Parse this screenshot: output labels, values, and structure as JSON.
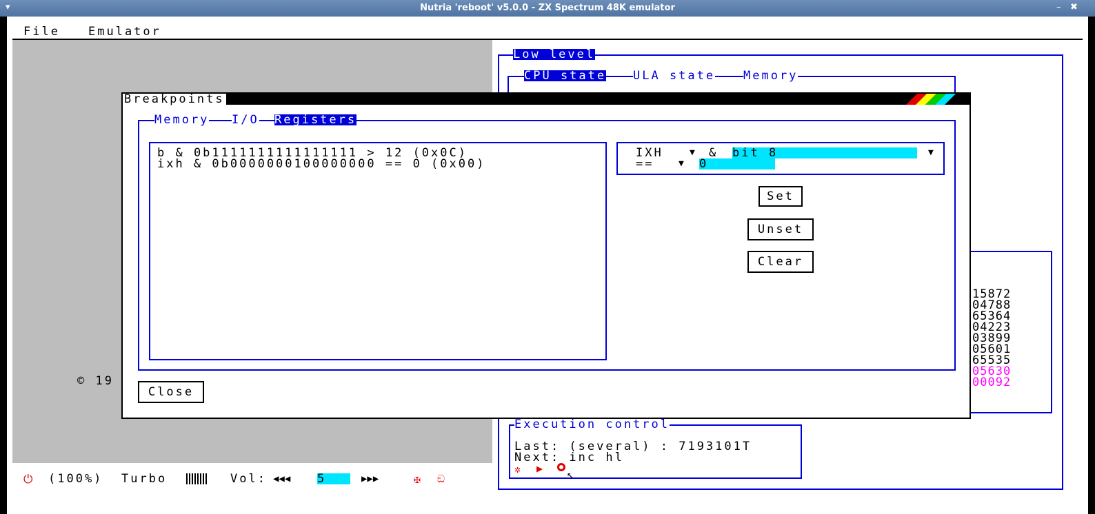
{
  "window": {
    "title": "Nutria 'reboot' v5.0.0 - ZX Spectrum 48K emulator",
    "minimize_glyph": "–",
    "close_glyph": "✖",
    "menu_glyph": "▾"
  },
  "menubar": {
    "items": [
      "File",
      "Emulator"
    ]
  },
  "background": {
    "copyright_partial": "© 19"
  },
  "low_level": {
    "title": "Low level",
    "tabs": [
      "CPU state",
      "ULA state",
      "Memory"
    ],
    "numbers": [
      {
        "value": "15872",
        "color": "#000000"
      },
      {
        "value": "04788",
        "color": "#000000"
      },
      {
        "value": "65364",
        "color": "#000000"
      },
      {
        "value": "04223",
        "color": "#000000"
      },
      {
        "value": "03899",
        "color": "#000000"
      },
      {
        "value": "05601",
        "color": "#000000"
      },
      {
        "value": "65535",
        "color": "#000000"
      },
      {
        "value": "05630",
        "color": "#ff00ff"
      },
      {
        "value": "00092",
        "color": "#ff00ff"
      }
    ],
    "exec": {
      "title": "Execution control",
      "last": "Last: (several) : 7193101T",
      "next": "Next: inc hl"
    }
  },
  "statusbar": {
    "speed": "(100%)",
    "turbo": "Turbo",
    "vol_label": "Vol:",
    "vol_value": "5"
  },
  "dialog": {
    "title": "Breakpoints",
    "tabs": [
      "Memory",
      "I/O",
      "Registers"
    ],
    "active_tab": "Registers",
    "breakpoints": [
      "b & 0b1111111111111111 > 12 (0x0C)",
      "ixh & 0b0000000100000000 == 0 (0x00)"
    ],
    "editor": {
      "register": "IXH",
      "and_op": "&",
      "mask": "bit 8",
      "comparison": "==",
      "value": "0"
    },
    "buttons": {
      "set": "Set",
      "unset": "Unset",
      "clear": "Clear",
      "close": "Close"
    }
  },
  "colors": {
    "zx_blue": "#0000d8",
    "zx_cyan": "#00e5ff",
    "zx_magenta": "#ff00ff",
    "zx_red": "#e00000"
  }
}
